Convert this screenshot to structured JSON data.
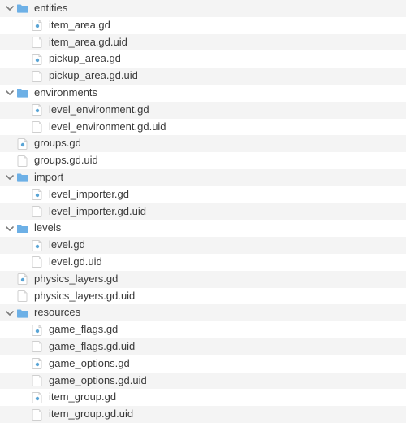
{
  "colors": {
    "folder": "#6db0e6",
    "script_dot": "#5aa5d6",
    "file_fold": "#d9d9d9",
    "row_alt": "#f4f4f4",
    "text": "#3a3a3a",
    "chevron": "#7b7b7b"
  },
  "tree": [
    {
      "depth": 0,
      "type": "folder",
      "expanded": true,
      "name_key": "n0",
      "label": "entities"
    },
    {
      "depth": 1,
      "type": "script",
      "name_key": "n1",
      "label": "item_area.gd"
    },
    {
      "depth": 1,
      "type": "file",
      "name_key": "n2",
      "label": "item_area.gd.uid"
    },
    {
      "depth": 1,
      "type": "script",
      "name_key": "n3",
      "label": "pickup_area.gd"
    },
    {
      "depth": 1,
      "type": "file",
      "name_key": "n4",
      "label": "pickup_area.gd.uid"
    },
    {
      "depth": 0,
      "type": "folder",
      "expanded": true,
      "name_key": "n5",
      "label": "environments"
    },
    {
      "depth": 1,
      "type": "script",
      "name_key": "n6",
      "label": "level_environment.gd"
    },
    {
      "depth": 1,
      "type": "file",
      "name_key": "n7",
      "label": "level_environment.gd.uid"
    },
    {
      "depth": 0,
      "type": "script",
      "name_key": "n8",
      "label": "groups.gd"
    },
    {
      "depth": 0,
      "type": "file",
      "name_key": "n9",
      "label": "groups.gd.uid"
    },
    {
      "depth": 0,
      "type": "folder",
      "expanded": true,
      "name_key": "n10",
      "label": "import"
    },
    {
      "depth": 1,
      "type": "script",
      "name_key": "n11",
      "label": "level_importer.gd"
    },
    {
      "depth": 1,
      "type": "file",
      "name_key": "n12",
      "label": "level_importer.gd.uid"
    },
    {
      "depth": 0,
      "type": "folder",
      "expanded": true,
      "name_key": "n13",
      "label": "levels"
    },
    {
      "depth": 1,
      "type": "script",
      "name_key": "n14",
      "label": "level.gd"
    },
    {
      "depth": 1,
      "type": "file",
      "name_key": "n15",
      "label": "level.gd.uid"
    },
    {
      "depth": 0,
      "type": "script",
      "name_key": "n16",
      "label": "physics_layers.gd"
    },
    {
      "depth": 0,
      "type": "file",
      "name_key": "n17",
      "label": "physics_layers.gd.uid"
    },
    {
      "depth": 0,
      "type": "folder",
      "expanded": true,
      "name_key": "n18",
      "label": "resources"
    },
    {
      "depth": 1,
      "type": "script",
      "name_key": "n19",
      "label": "game_flags.gd"
    },
    {
      "depth": 1,
      "type": "file",
      "name_key": "n20",
      "label": "game_flags.gd.uid"
    },
    {
      "depth": 1,
      "type": "script",
      "name_key": "n21",
      "label": "game_options.gd"
    },
    {
      "depth": 1,
      "type": "file",
      "name_key": "n22",
      "label": "game_options.gd.uid"
    },
    {
      "depth": 1,
      "type": "script",
      "name_key": "n23",
      "label": "item_group.gd"
    },
    {
      "depth": 1,
      "type": "file",
      "name_key": "n24",
      "label": "item_group.gd.uid"
    }
  ]
}
